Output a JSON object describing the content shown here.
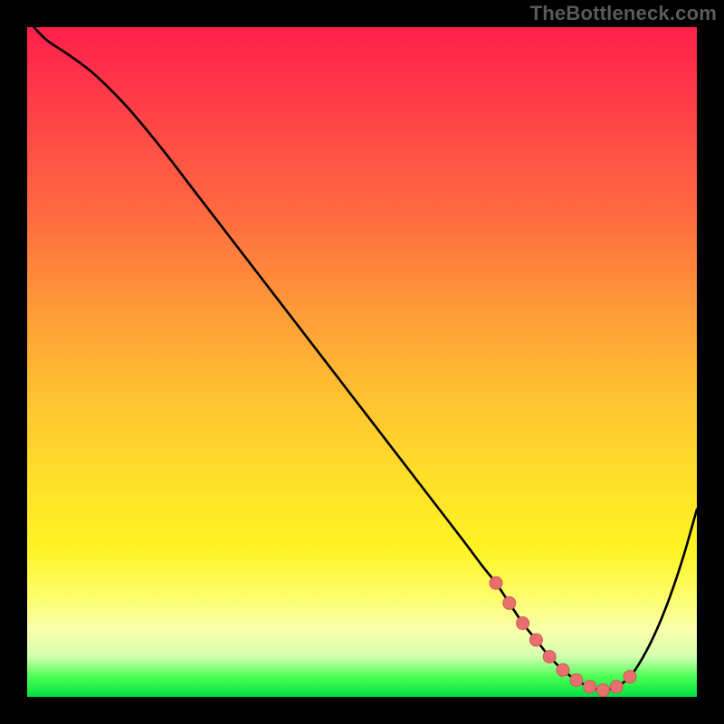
{
  "watermark": "TheBottleneck.com",
  "colors": {
    "background": "#000000",
    "curve": "#000000",
    "marker_fill": "#e76f6f",
    "marker_stroke": "#cf5a5a",
    "gradient_top": "#ff1f4a",
    "gradient_bottom": "#00e040"
  },
  "chart_data": {
    "type": "line",
    "title": "",
    "xlabel": "",
    "ylabel": "",
    "xlim": [
      0,
      100
    ],
    "ylim": [
      0,
      100
    ],
    "grid": false,
    "legend": false,
    "series": [
      {
        "name": "bottleneck-curve",
        "x": [
          1,
          3,
          6,
          10,
          15,
          20,
          25,
          30,
          35,
          40,
          45,
          50,
          55,
          60,
          65,
          68,
          70,
          72,
          74,
          76,
          78,
          80,
          82,
          84,
          86,
          88,
          90,
          92,
          94,
          96,
          98,
          100
        ],
        "y": [
          100,
          98,
          96,
          93,
          88,
          82,
          75.5,
          69,
          62.5,
          56,
          49.5,
          43,
          36.5,
          30,
          23.5,
          19.5,
          17,
          14,
          11,
          8.5,
          6,
          4,
          2.5,
          1.5,
          1,
          1.5,
          3,
          6,
          10,
          15,
          21,
          28
        ]
      }
    ],
    "markers": {
      "name": "optimal-range",
      "x": [
        70,
        72,
        74,
        76,
        78,
        80,
        82,
        84,
        86,
        88,
        90
      ],
      "y": [
        17,
        14,
        11,
        8.5,
        6,
        4,
        2.5,
        1.5,
        1,
        1.5,
        3
      ]
    }
  }
}
